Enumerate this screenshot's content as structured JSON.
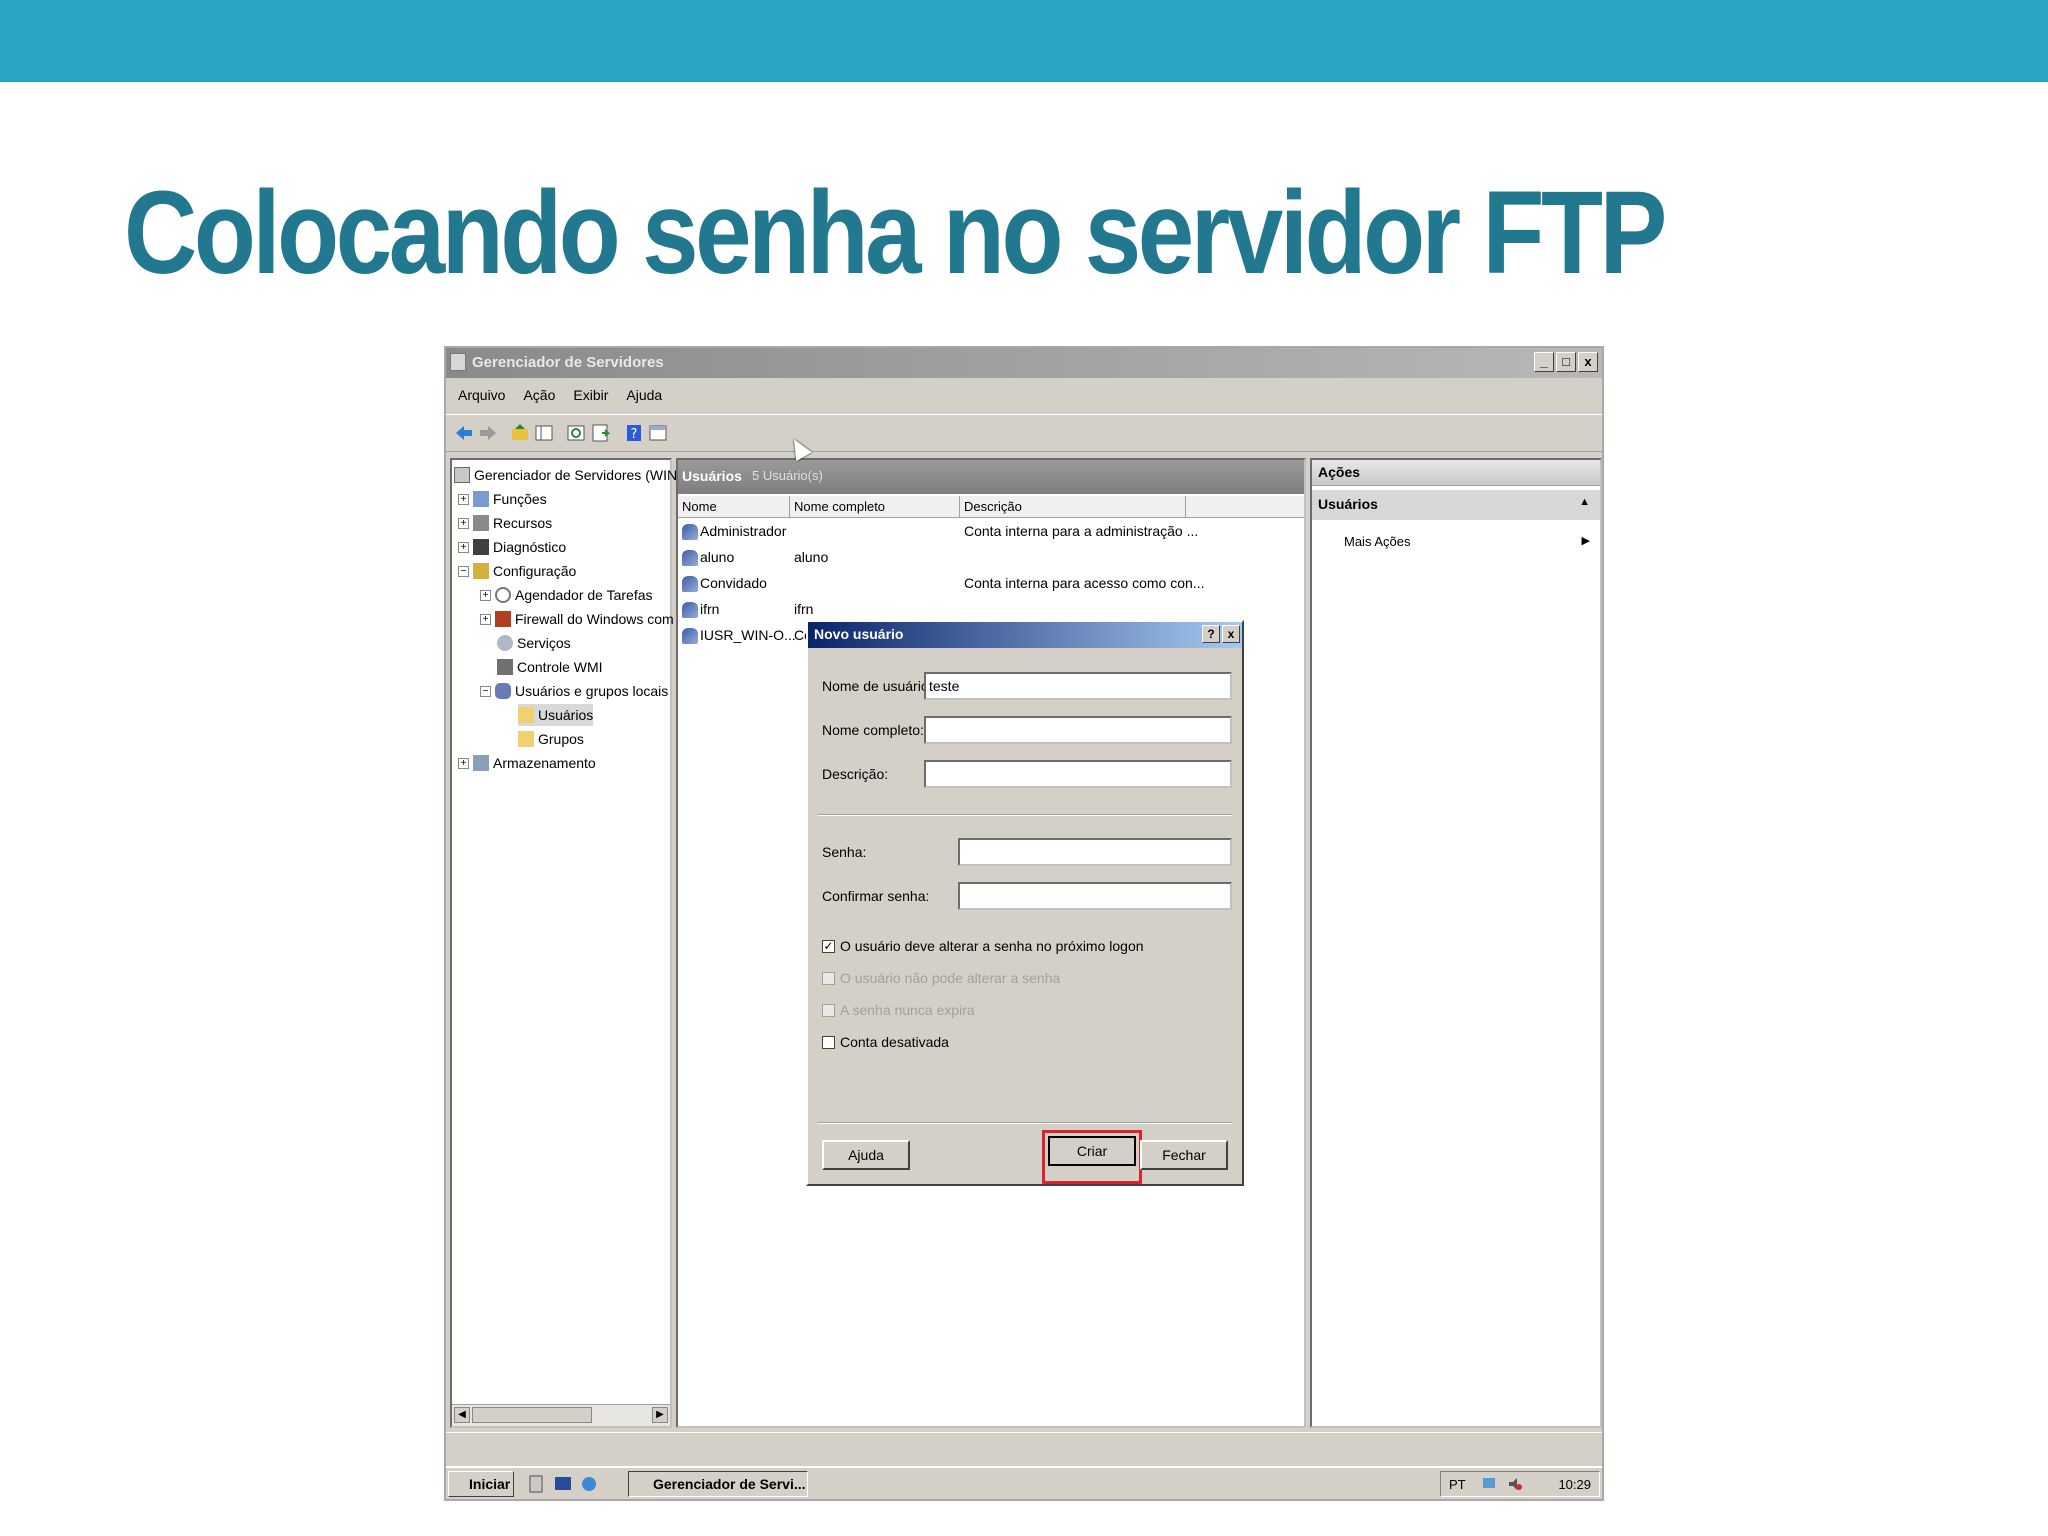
{
  "slide": {
    "title": "Colocando senha no servidor FTP",
    "accent_color": "#2ba3c2",
    "title_color": "#21788f"
  },
  "window": {
    "title": "Gerenciador de Servidores",
    "controls": [
      "_",
      "□",
      "x"
    ],
    "menu": [
      "Arquivo",
      "Ação",
      "Exibir",
      "Ajuda"
    ]
  },
  "tree": {
    "items": [
      {
        "label": "Gerenciador de Servidores (WIN-OI",
        "icon": "server-icon"
      },
      {
        "label": "Funções",
        "icon": "roles-icon"
      },
      {
        "label": "Recursos",
        "icon": "features-icon"
      },
      {
        "label": "Diagnóstico",
        "icon": "diagnostics-icon"
      },
      {
        "label": "Configuração",
        "icon": "configuration-icon"
      },
      {
        "label": "Agendador de Tarefas",
        "icon": "clock-icon"
      },
      {
        "label": "Firewall do Windows com Se",
        "icon": "firewall-icon"
      },
      {
        "label": "Serviços",
        "icon": "services-icon"
      },
      {
        "label": "Controle WMI",
        "icon": "wmi-icon"
      },
      {
        "label": "Usuários e grupos locais",
        "icon": "users-groups-icon"
      },
      {
        "label": "Usuários",
        "icon": "folder-icon"
      },
      {
        "label": "Grupos",
        "icon": "folder-icon"
      },
      {
        "label": "Armazenamento",
        "icon": "storage-icon"
      }
    ]
  },
  "list": {
    "header": "Usuários",
    "count": "5 Usuário(s)",
    "columns": [
      "Nome",
      "Nome completo",
      "Descrição"
    ],
    "rows": [
      {
        "name": "Administrador",
        "full_name": "",
        "description": "Conta interna para a administração ..."
      },
      {
        "name": "aluno",
        "full_name": "aluno",
        "description": ""
      },
      {
        "name": "Convidado",
        "full_name": "",
        "description": "Conta interna para acesso como con..."
      },
      {
        "name": "ifrn",
        "full_name": "ifrn",
        "description": ""
      },
      {
        "name": "IUSR_WIN-O...",
        "full_name": "Co",
        "description": ""
      }
    ]
  },
  "actions": {
    "header": "Ações",
    "section": "Usuários",
    "item": "Mais Ações"
  },
  "dialog": {
    "title": "Novo usuário",
    "help_button": "?",
    "close_button": "x",
    "username_label": "Nome de usuário:",
    "username_value": "teste",
    "fullname_label": "Nome completo:",
    "fullname_value": "",
    "description_label": "Descrição:",
    "description_value": "",
    "password_label": "Senha:",
    "confirm_label": "Confirmar senha:",
    "checkboxes": [
      {
        "label": "O usuário deve alterar a senha no próximo logon",
        "checked": true,
        "enabled": true
      },
      {
        "label": "O usuário não pode alterar a senha",
        "checked": false,
        "enabled": false
      },
      {
        "label": "A senha nunca expira",
        "checked": false,
        "enabled": false
      },
      {
        "label": "Conta desativada",
        "checked": false,
        "enabled": true
      }
    ],
    "help_btn": "Ajuda",
    "create_btn": "Criar",
    "close_btn": "Fechar",
    "highlight_color": "#d9242c"
  },
  "taskbar": {
    "start": "Iniciar",
    "task": "Gerenciador de Servi...",
    "lang": "PT",
    "clock": "10:29"
  }
}
